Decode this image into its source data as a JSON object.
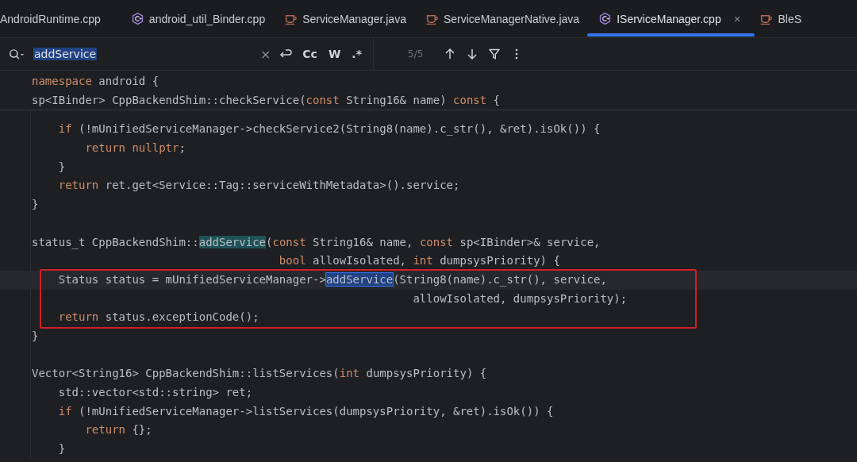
{
  "tabs": [
    {
      "label": "AndroidRuntime.cpp",
      "kind": "none",
      "selected": false
    },
    {
      "label": "android_util_Binder.cpp",
      "kind": "cpp",
      "selected": false
    },
    {
      "label": "ServiceManager.java",
      "kind": "java",
      "selected": false
    },
    {
      "label": "ServiceManagerNative.java",
      "kind": "java",
      "selected": false
    },
    {
      "label": "IServiceManager.cpp",
      "kind": "cpp",
      "selected": true,
      "close": "×"
    },
    {
      "label": "BleS",
      "kind": "java",
      "selected": false
    }
  ],
  "search": {
    "value": "addService",
    "clear": "×",
    "options": [
      "Cc",
      "W",
      ".*"
    ],
    "count": "5/5"
  },
  "sticky_lines": [
    [
      {
        "kind": "kw",
        "t": "namespace"
      },
      {
        "kind": "pl",
        "t": " android {"
      }
    ],
    [
      {
        "kind": "pl",
        "t": "sp<IBinder> CppBackendShim::checkService("
      },
      {
        "kind": "kw",
        "t": "const"
      },
      {
        "kind": "pl",
        "t": " String16& name) "
      },
      {
        "kind": "kw",
        "t": "const"
      },
      {
        "kind": "pl",
        "t": " {"
      }
    ]
  ],
  "code_blocks": [
    {
      "boxed": false,
      "lines": [
        {
          "current": false,
          "segments": [
            {
              "kind": "kw",
              "t": "    if"
            },
            {
              "kind": "pl",
              "t": " (!mUnifiedServiceManager->checkService2(String8(name).c_str(), &ret).isOk()) {"
            }
          ]
        },
        {
          "current": false,
          "segments": [
            {
              "kind": "kw",
              "t": "        return nullptr"
            },
            {
              "kind": "pl",
              "t": ";"
            }
          ]
        },
        {
          "current": false,
          "segments": [
            {
              "kind": "pl",
              "t": "    }"
            }
          ]
        },
        {
          "current": false,
          "segments": [
            {
              "kind": "kw",
              "t": "    return"
            },
            {
              "kind": "pl",
              "t": " ret.get<Service::Tag::serviceWithMetadata>().service;"
            }
          ]
        },
        {
          "current": false,
          "segments": [
            {
              "kind": "pl",
              "t": "}"
            }
          ]
        },
        {
          "current": false
        },
        {
          "current": false,
          "segments": [
            {
              "kind": "pl",
              "t": "status_t CppBackendShim::"
            },
            {
              "kind": "match",
              "t": "addService"
            },
            {
              "kind": "pl",
              "t": "("
            },
            {
              "kind": "kw",
              "t": "const"
            },
            {
              "kind": "pl",
              "t": " String16& name, "
            },
            {
              "kind": "kw",
              "t": "const"
            },
            {
              "kind": "pl",
              "t": " sp<IBinder>& service,"
            }
          ]
        },
        {
          "current": false,
          "segments": [
            {
              "kind": "kw",
              "t": "                                     bool"
            },
            {
              "kind": "pl",
              "t": " allowIsolated, "
            },
            {
              "kind": "kw",
              "t": "int"
            },
            {
              "kind": "pl",
              "t": " dumpsysPriority) {"
            }
          ]
        }
      ]
    },
    {
      "boxed": true,
      "lines": [
        {
          "current": true,
          "segments": [
            {
              "kind": "pl",
              "t": "    Status status = mUnifiedServiceManager->"
            },
            {
              "kind": "current",
              "t": "addService"
            },
            {
              "kind": "pl",
              "t": "(String8(name).c_str(), service,"
            }
          ]
        },
        {
          "current": false,
          "segments": [
            {
              "kind": "pl",
              "t": "                                                         allowIsolated, dumpsysPriority);"
            }
          ]
        },
        {
          "current": false,
          "segments": [
            {
              "kind": "kw",
              "t": "    return"
            },
            {
              "kind": "pl",
              "t": " status.exceptionCode();"
            }
          ]
        }
      ]
    },
    {
      "boxed": false,
      "lines": [
        {
          "current": false,
          "segments": [
            {
              "kind": "pl",
              "t": "}"
            }
          ]
        },
        {
          "current": false
        },
        {
          "current": false,
          "segments": [
            {
              "kind": "pl",
              "t": "Vector<String16> CppBackendShim::listServices("
            },
            {
              "kind": "kw",
              "t": "int"
            },
            {
              "kind": "pl",
              "t": " dumpsysPriority) {"
            }
          ]
        },
        {
          "current": false,
          "segments": [
            {
              "kind": "pl",
              "t": "    std::vector<std::string> ret;"
            }
          ]
        },
        {
          "current": false,
          "segments": [
            {
              "kind": "kw",
              "t": "    if"
            },
            {
              "kind": "pl",
              "t": " (!mUnifiedServiceManager->listServices(dumpsysPriority, &ret).isOk()) {"
            }
          ]
        },
        {
          "current": false,
          "segments": [
            {
              "kind": "kw",
              "t": "        return"
            },
            {
              "kind": "pl",
              "t": " {};"
            }
          ]
        },
        {
          "current": false,
          "segments": [
            {
              "kind": "pl",
              "t": "    }"
            }
          ]
        }
      ]
    }
  ]
}
